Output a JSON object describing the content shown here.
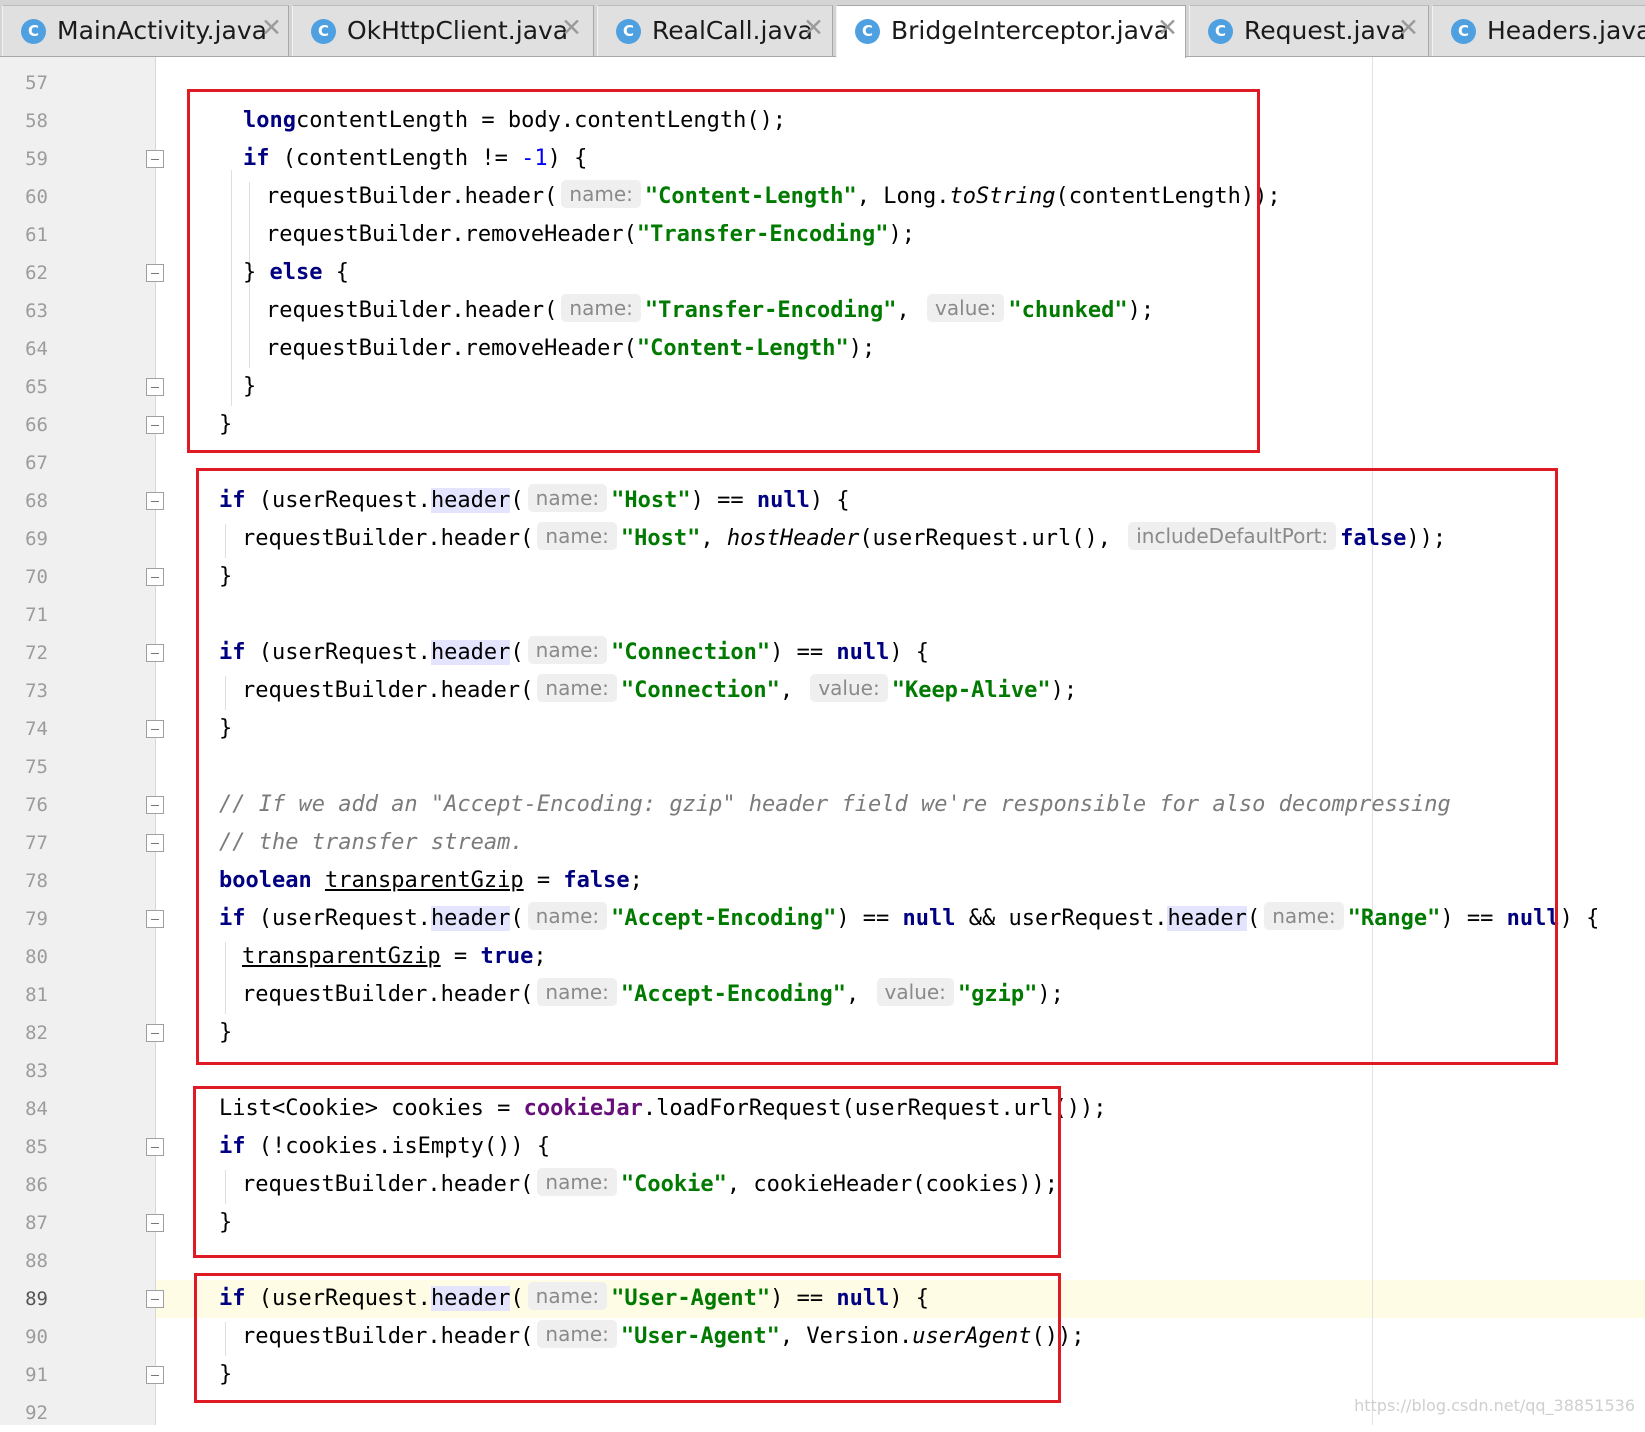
{
  "tabs": [
    {
      "label": "MainActivity.java",
      "icon": "java-class-icon",
      "icon_letter": "C",
      "closable": true,
      "active": false
    },
    {
      "label": "OkHttpClient.java",
      "icon": "java-class-icon",
      "icon_letter": "C",
      "closable": true,
      "active": false
    },
    {
      "label": "RealCall.java",
      "icon": "java-class-icon",
      "icon_letter": "C",
      "closable": true,
      "active": false
    },
    {
      "label": "BridgeInterceptor.java",
      "icon": "java-class-icon",
      "icon_letter": "C",
      "closable": true,
      "active": true
    },
    {
      "label": "Request.java",
      "icon": "java-class-icon",
      "icon_letter": "C",
      "closable": true,
      "active": false
    },
    {
      "label": "Headers.java",
      "icon": "java-class-icon",
      "icon_letter": "C",
      "closable": false,
      "active": false
    }
  ],
  "close_glyph": "✕",
  "editor": {
    "current_line": 89,
    "line_numbers": [
      "57",
      "58",
      "59",
      "60",
      "61",
      "62",
      "63",
      "64",
      "65",
      "66",
      "67",
      "68",
      "69",
      "70",
      "71",
      "72",
      "73",
      "74",
      "75",
      "76",
      "77",
      "78",
      "79",
      "80",
      "81",
      "82",
      "83",
      "84",
      "85",
      "86",
      "87",
      "88",
      "89",
      "90",
      "91",
      "92"
    ],
    "fold_marker_lines": [
      59,
      62,
      65,
      66,
      68,
      70,
      72,
      74,
      76,
      77,
      79,
      82,
      85,
      87,
      89,
      91
    ],
    "code": {
      "l58": [
        [
          "k",
          "long"
        ],
        [
          "",
          "contentLength = body.contentLength();"
        ]
      ],
      "l59": [
        [
          "k",
          "if"
        ],
        [
          "",
          " (contentLength != "
        ],
        [
          "n",
          "-1"
        ],
        [
          "",
          ") {"
        ]
      ],
      "l60": [
        [
          "",
          "requestBuilder.header("
        ],
        [
          "hint",
          "name:"
        ],
        [
          "s",
          "\"Content-Length\""
        ],
        [
          "",
          ", Long."
        ],
        [
          "it",
          "toString"
        ],
        [
          "",
          "(contentLength));"
        ]
      ],
      "l61": [
        [
          "",
          "requestBuilder.removeHeader("
        ],
        [
          "s",
          "\"Transfer-Encoding\""
        ],
        [
          "",
          ");"
        ]
      ],
      "l62": [
        [
          "",
          "} "
        ],
        [
          "k",
          "else"
        ],
        [
          "",
          " {"
        ]
      ],
      "l63": [
        [
          "",
          "requestBuilder.header("
        ],
        [
          "hint",
          "name:"
        ],
        [
          "s",
          "\"Transfer-Encoding\""
        ],
        [
          "",
          ", "
        ],
        [
          "hint",
          "value:"
        ],
        [
          "s",
          "\"chunked\""
        ],
        [
          "",
          ");"
        ]
      ],
      "l64": [
        [
          "",
          "requestBuilder.removeHeader("
        ],
        [
          "s",
          "\"Content-Length\""
        ],
        [
          "",
          ");"
        ]
      ],
      "l65": [
        [
          "",
          "}"
        ]
      ],
      "l66": [
        [
          "",
          "}"
        ]
      ],
      "l68": [
        [
          "k",
          "if"
        ],
        [
          "",
          " (userRequest."
        ],
        [
          "mark",
          "header"
        ],
        [
          "",
          "("
        ],
        [
          "hint",
          "name:"
        ],
        [
          "s",
          "\"Host\""
        ],
        [
          "",
          ") == "
        ],
        [
          "k",
          "null"
        ],
        [
          "",
          ") {"
        ]
      ],
      "l69": [
        [
          "",
          "requestBuilder.header("
        ],
        [
          "hint",
          "name:"
        ],
        [
          "s",
          "\"Host\""
        ],
        [
          "",
          ", "
        ],
        [
          "it",
          "hostHeader"
        ],
        [
          "",
          "(userRequest.url(), "
        ],
        [
          "hint",
          "includeDefaultPort:"
        ],
        [
          "k",
          "false"
        ],
        [
          "",
          "));"
        ]
      ],
      "l70": [
        [
          "",
          "}"
        ]
      ],
      "l72": [
        [
          "k",
          "if"
        ],
        [
          "",
          " (userRequest."
        ],
        [
          "mark",
          "header"
        ],
        [
          "",
          "("
        ],
        [
          "hint",
          "name:"
        ],
        [
          "s",
          "\"Connection\""
        ],
        [
          "",
          ") == "
        ],
        [
          "k",
          "null"
        ],
        [
          "",
          ") {"
        ]
      ],
      "l73": [
        [
          "",
          "requestBuilder.header("
        ],
        [
          "hint",
          "name:"
        ],
        [
          "s",
          "\"Connection\""
        ],
        [
          "",
          ", "
        ],
        [
          "hint",
          "value:"
        ],
        [
          "s",
          "\"Keep-Alive\""
        ],
        [
          "",
          ");"
        ]
      ],
      "l74": [
        [
          "",
          "}"
        ]
      ],
      "l76": [
        [
          "c",
          "// If we add an \"Accept-Encoding: gzip\" header field we're responsible for also decompressing"
        ]
      ],
      "l77": [
        [
          "c",
          "// the transfer stream."
        ]
      ],
      "l78": [
        [
          "k",
          "boolean"
        ],
        [
          "",
          " "
        ],
        [
          "u",
          "transparentGzip"
        ],
        [
          "",
          " = "
        ],
        [
          "k",
          "false"
        ],
        [
          "",
          ";"
        ]
      ],
      "l79": [
        [
          "k",
          "if"
        ],
        [
          "",
          " (userRequest."
        ],
        [
          "mark",
          "header"
        ],
        [
          "",
          "("
        ],
        [
          "hint",
          "name:"
        ],
        [
          "s",
          "\"Accept-Encoding\""
        ],
        [
          "",
          ") == "
        ],
        [
          "k",
          "null"
        ],
        [
          "",
          " && userRequest."
        ],
        [
          "mark",
          "header"
        ],
        [
          "",
          "("
        ],
        [
          "hint",
          "name:"
        ],
        [
          "s",
          "\"Range\""
        ],
        [
          "",
          ") == "
        ],
        [
          "k",
          "null"
        ],
        [
          "",
          ") {"
        ]
      ],
      "l80": [
        [
          "u",
          "transparentGzip"
        ],
        [
          "",
          " = "
        ],
        [
          "k",
          "true"
        ],
        [
          "",
          ";"
        ]
      ],
      "l81": [
        [
          "",
          "requestBuilder.header("
        ],
        [
          "hint",
          "name:"
        ],
        [
          "s",
          "\"Accept-Encoding\""
        ],
        [
          "",
          ", "
        ],
        [
          "hint",
          "value:"
        ],
        [
          "s",
          "\"gzip\""
        ],
        [
          "",
          ");"
        ]
      ],
      "l82": [
        [
          "",
          "}"
        ]
      ],
      "l84": [
        [
          "",
          "List<Cookie> cookies = "
        ],
        [
          "f",
          "cookieJar"
        ],
        [
          "",
          ".loadForRequest(userRequest.url());"
        ]
      ],
      "l85": [
        [
          "k",
          "if"
        ],
        [
          "",
          " (!cookies.isEmpty()) {"
        ]
      ],
      "l86": [
        [
          "",
          "requestBuilder.header("
        ],
        [
          "hint",
          "name:"
        ],
        [
          "s",
          "\"Cookie\""
        ],
        [
          "",
          ", cookieHeader(cookies));"
        ]
      ],
      "l87": [
        [
          "",
          "}"
        ]
      ],
      "l89": [
        [
          "k",
          "if"
        ],
        [
          "",
          " (userRequest."
        ],
        [
          "mark",
          "header"
        ],
        [
          "",
          "("
        ],
        [
          "hint",
          "name:"
        ],
        [
          "s",
          "\"User-Agent\""
        ],
        [
          "",
          ") == "
        ],
        [
          "k",
          "null"
        ],
        [
          "",
          ") {"
        ]
      ],
      "l90": [
        [
          "",
          "requestBuilder.header("
        ],
        [
          "hint",
          "name:"
        ],
        [
          "s",
          "\"User-Agent\""
        ],
        [
          "",
          ", Version."
        ],
        [
          "it",
          "userAgent"
        ],
        [
          "",
          "());"
        ]
      ],
      "l91": [
        [
          "",
          "}"
        ]
      ]
    }
  },
  "annotation_boxes": [
    "content-length-block",
    "host-connection-gzip-block",
    "cookie-block",
    "user-agent-block"
  ],
  "colors": {
    "keyword": "#000080",
    "string": "#007a00",
    "number": "#0000ff",
    "comment": "#7b7b7b",
    "field": "#660e7a",
    "annotation_box": "#e01a24",
    "current_line": "#fefce4"
  },
  "watermark": "https://blog.csdn.net/qq_38851536"
}
